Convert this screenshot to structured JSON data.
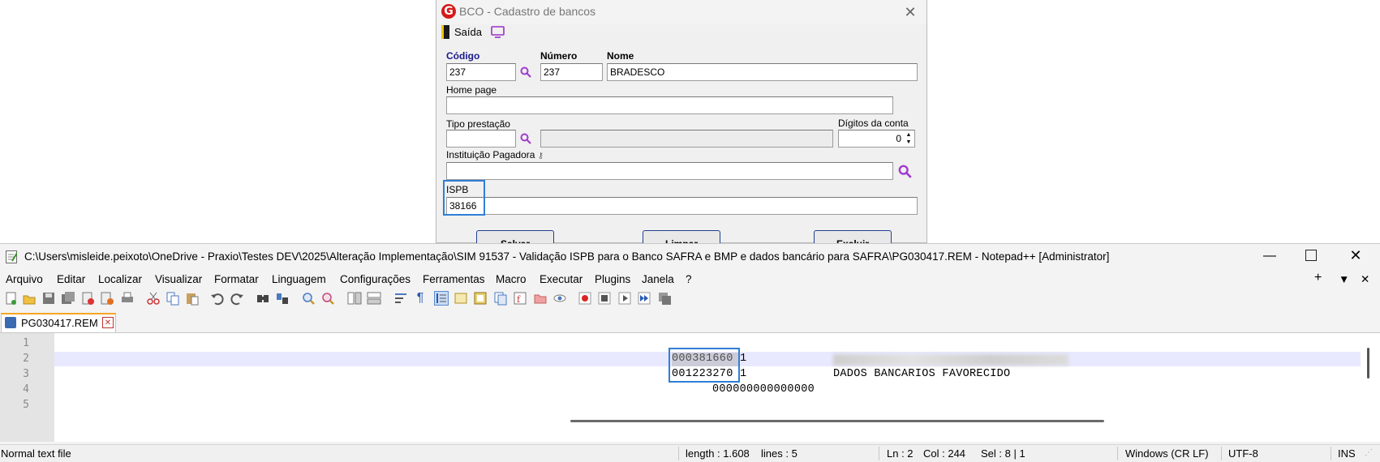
{
  "bco": {
    "title": "BCO - Cadastro de bancos",
    "toolbar": {
      "exit_label": "Saída"
    },
    "labels": {
      "codigo": "Código",
      "numero": "Número",
      "nome": "Nome",
      "home_page": "Home page",
      "tipo_prestacao": "Tipo prestação",
      "digitos_conta": "Dígitos da conta",
      "instituicao_pagadora": "Instituição Pagadora",
      "ispb": "ISPB"
    },
    "values": {
      "codigo": "237",
      "numero": "237",
      "nome": "BRADESCO",
      "home_page": "",
      "tipo_prestacao": "",
      "tipo_prestacao_desc": "",
      "digitos_conta": "0",
      "instituicao_pagadora": "",
      "ispb": "38166"
    },
    "buttons": {
      "save": "Salvar",
      "clear": "Limpar",
      "delete": "Excluir"
    }
  },
  "npp": {
    "title": "C:\\Users\\misleide.peixoto\\OneDrive - Praxio\\Testes DEV\\2025\\Alteração Implementação\\SIM 91537 - Validação ISPB para o Banco SAFRA e BMP e dados bancário para SAFRA\\PG030417.REM - Notepad++ [Administrator]",
    "menu": [
      "Arquivo",
      "Editar",
      "Localizar",
      "Visualizar",
      "Formatar",
      "Linguagem",
      "Configurações",
      "Ferramentas",
      "Macro",
      "Executar",
      "Plugins",
      "Janela",
      "?"
    ],
    "menu_right": {
      "plus": "+",
      "down": "▼",
      "close": "✕"
    },
    "tab": "PG030417.REM",
    "lines": [
      {
        "num": "1",
        "text": ""
      },
      {
        "num": "2",
        "text": "000381660 1"
      },
      {
        "num": "3",
        "text": "001223270 1",
        "tail": "DADOS BANCARIOS FAVORECIDO"
      },
      {
        "num": "4",
        "text": "000000000000000"
      },
      {
        "num": "5",
        "text": ""
      }
    ],
    "status": {
      "type": "Normal text file",
      "length": "length : 1.608",
      "lines": "lines : 5",
      "ln": "Ln : 2",
      "col": "Col : 244",
      "sel": "Sel : 8 | 1",
      "eol": "Windows (CR LF)",
      "encoding": "UTF-8",
      "mode": "INS"
    }
  }
}
